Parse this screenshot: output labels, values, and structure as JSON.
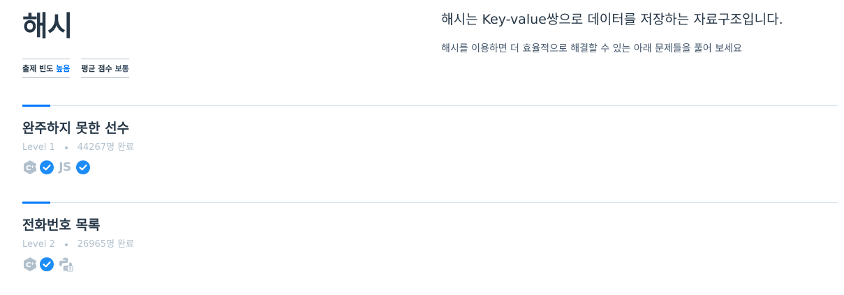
{
  "header": {
    "title": "해시",
    "stats": [
      {
        "label": "출제 빈도",
        "value": "높음"
      },
      {
        "label": "평균 점수",
        "value": "보통"
      }
    ],
    "headline": "해시는 Key-value쌍으로 데이터를 저장하는 자료구조입니다.",
    "description": "해시를 이용하면 더 효율적으로 해결할 수 있는 아래 문제들을 풀어 보세요"
  },
  "problems": [
    {
      "title": "완주하지 못한 선수",
      "level": "Level 1",
      "completed": "44267명 완료",
      "languages": [
        {
          "icon": "cpp-icon",
          "solved": true
        },
        {
          "label": "JS",
          "icon": "javascript-icon",
          "solved": true
        }
      ]
    },
    {
      "title": "전화번호 목록",
      "level": "Level 2",
      "completed": "26965명 완료",
      "languages": [
        {
          "icon": "cpp-icon",
          "solved": true
        },
        {
          "icon": "python-icon",
          "solved": false
        }
      ]
    }
  ],
  "colors": {
    "accent": "#0078ff",
    "text": "#263747",
    "muted": "#b2c0cc",
    "check": "#1c8cf7"
  }
}
